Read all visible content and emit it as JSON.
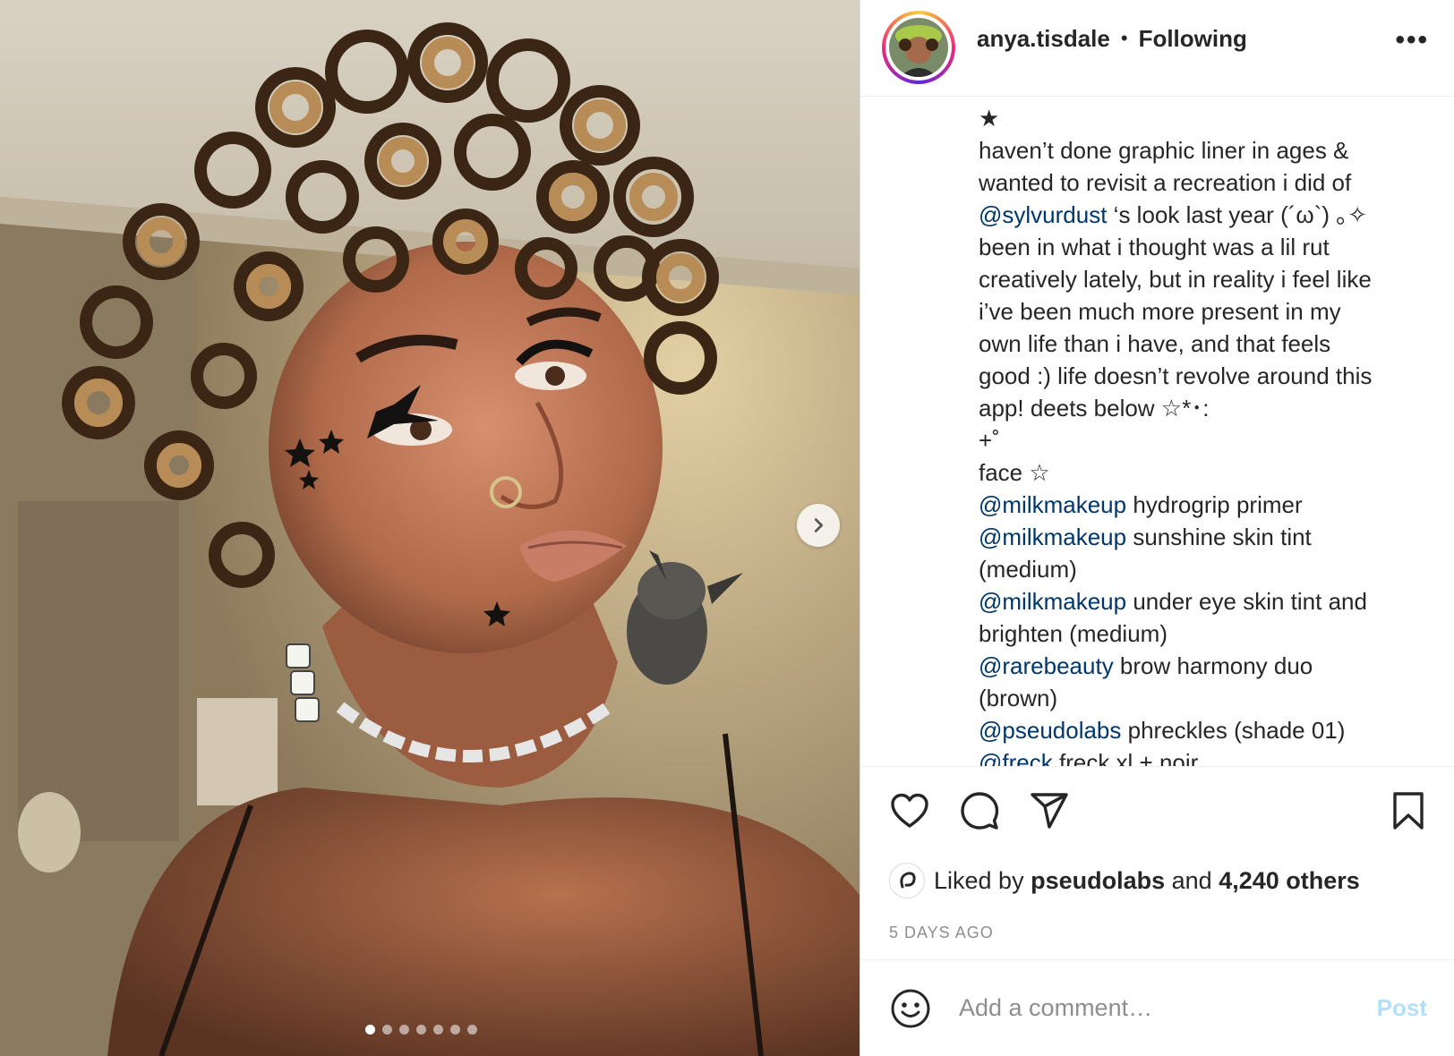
{
  "header": {
    "username": "anya.tisdale",
    "separator": "•",
    "follow_status": "Following",
    "more_label": "•••"
  },
  "caption": {
    "lines": [
      {
        "parts": [
          {
            "text": "★",
            "mention": false
          }
        ]
      },
      {
        "parts": [
          {
            "text": "haven’t done graphic liner in ages &",
            "mention": false
          }
        ]
      },
      {
        "parts": [
          {
            "text": "wanted to revisit a recreation i did of",
            "mention": false
          }
        ]
      },
      {
        "parts": [
          {
            "text": "@sylvurdust",
            "mention": true
          },
          {
            "text": " ‘s look last year (´ω`) ｡✧",
            "mention": false
          }
        ]
      },
      {
        "parts": [
          {
            "text": "been in what i thought was a lil rut",
            "mention": false
          }
        ]
      },
      {
        "parts": [
          {
            "text": "creatively lately, but in reality i feel like",
            "mention": false
          }
        ]
      },
      {
        "parts": [
          {
            "text": "i’ve been much more present in my",
            "mention": false
          }
        ]
      },
      {
        "parts": [
          {
            "text": "own life than i have, and that feels",
            "mention": false
          }
        ]
      },
      {
        "parts": [
          {
            "text": "good :) life doesn’t revolve around this",
            "mention": false
          }
        ]
      },
      {
        "parts": [
          {
            "text": "app! deets below ☆*･:",
            "mention": false
          }
        ]
      },
      {
        "parts": [
          {
            "text": "+˚",
            "mention": false
          }
        ]
      },
      {
        "parts": [
          {
            "text": "face ☆",
            "mention": false
          }
        ]
      },
      {
        "parts": [
          {
            "text": "@milkmakeup",
            "mention": true
          },
          {
            "text": " hydrogrip primer",
            "mention": false
          }
        ]
      },
      {
        "parts": [
          {
            "text": "@milkmakeup",
            "mention": true
          },
          {
            "text": " sunshine skin tint",
            "mention": false
          }
        ]
      },
      {
        "parts": [
          {
            "text": "(medium)",
            "mention": false
          }
        ]
      },
      {
        "parts": [
          {
            "text": "@milkmakeup",
            "mention": true
          },
          {
            "text": " under eye skin tint and",
            "mention": false
          }
        ]
      },
      {
        "parts": [
          {
            "text": "brighten (medium)",
            "mention": false
          }
        ]
      },
      {
        "parts": [
          {
            "text": "@rarebeauty",
            "mention": true
          },
          {
            "text": " brow harmony duo",
            "mention": false
          }
        ]
      },
      {
        "parts": [
          {
            "text": "(brown)",
            "mention": false
          }
        ]
      },
      {
        "parts": [
          {
            "text": "@pseudolabs",
            "mention": true
          },
          {
            "text": " phreckles (shade 01)",
            "mention": false
          }
        ]
      },
      {
        "parts": [
          {
            "text": "@freck",
            "mention": true
          },
          {
            "text": " freck xl + noir",
            "mention": false
          }
        ]
      }
    ]
  },
  "actions": {
    "like_icon": "heart-icon",
    "comment_icon": "comment-icon",
    "share_icon": "paper-plane-icon",
    "save_icon": "bookmark-icon"
  },
  "likes": {
    "prefix": "Liked by",
    "liker": "pseudolabs",
    "middle": "and",
    "count": "4,240 others"
  },
  "timestamp": "5 DAYS AGO",
  "comment": {
    "placeholder": "Add a comment…",
    "post_label": "Post"
  },
  "carousel": {
    "total": 7,
    "active_index": 0
  },
  "colors": {
    "mention": "#00376b",
    "post_disabled": "#b2dffc",
    "muted": "#8e8e8e"
  }
}
